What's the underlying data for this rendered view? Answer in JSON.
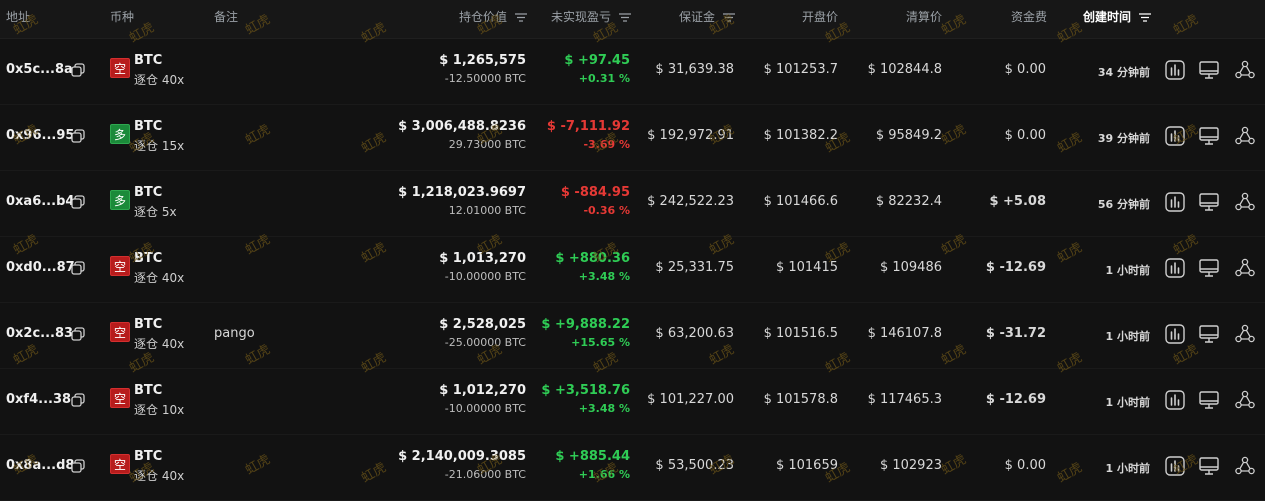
{
  "columns": {
    "address": "地址",
    "coin": "币种",
    "note": "备注",
    "position_value": "持仓价值",
    "unrealized_pnl": "未实现盈亏",
    "margin": "保证金",
    "open_price": "开盘价",
    "liq_price": "清算价",
    "funding": "资金费",
    "created": "创建时间"
  },
  "watermark": "虹虎",
  "rows": [
    {
      "address": "0x5c...8a",
      "side": "空",
      "side_type": "short",
      "coin": "BTC",
      "leverage": "逐仓 40x",
      "note": "",
      "value": "$ 1,265,575",
      "size": "-12.50000 BTC",
      "pnl": "$ +97.45",
      "pnl_pct": "+0.31 %",
      "pnl_dir": "pos",
      "margin": "$ 31,639.38",
      "open": "$ 101253.7",
      "liq": "$ 102844.8",
      "funding": "$ 0.00",
      "funding_dir": "zero",
      "created": "34 分钟前"
    },
    {
      "address": "0x96...95",
      "side": "多",
      "side_type": "long",
      "coin": "BTC",
      "leverage": "逐仓 15x",
      "note": "",
      "value": "$ 3,006,488.8236",
      "size": "29.73000 BTC",
      "pnl": "$ -7,111.92",
      "pnl_pct": "-3.69 %",
      "pnl_dir": "neg",
      "margin": "$ 192,972.91",
      "open": "$ 101382.2",
      "liq": "$ 95849.2",
      "funding": "$ 0.00",
      "funding_dir": "zero",
      "created": "39 分钟前"
    },
    {
      "address": "0xa6...b4",
      "side": "多",
      "side_type": "long",
      "coin": "BTC",
      "leverage": "逐仓 5x",
      "note": "",
      "value": "$ 1,218,023.9697",
      "size": "12.01000 BTC",
      "pnl": "$ -884.95",
      "pnl_pct": "-0.36 %",
      "pnl_dir": "neg",
      "margin": "$ 242,522.23",
      "open": "$ 101466.6",
      "liq": "$ 82232.4",
      "funding": "$ +5.08",
      "funding_dir": "pos",
      "created": "56 分钟前"
    },
    {
      "address": "0xd0...87",
      "side": "空",
      "side_type": "short",
      "coin": "BTC",
      "leverage": "逐仓 40x",
      "note": "",
      "value": "$ 1,013,270",
      "size": "-10.00000 BTC",
      "pnl": "$ +880.36",
      "pnl_pct": "+3.48 %",
      "pnl_dir": "pos",
      "margin": "$ 25,331.75",
      "open": "$ 101415",
      "liq": "$ 109486",
      "funding": "$ -12.69",
      "funding_dir": "neg",
      "created": "1 小时前"
    },
    {
      "address": "0x2c...83",
      "side": "空",
      "side_type": "short",
      "coin": "BTC",
      "leverage": "逐仓 40x",
      "note": "pango",
      "value": "$ 2,528,025",
      "size": "-25.00000 BTC",
      "pnl": "$ +9,888.22",
      "pnl_pct": "+15.65 %",
      "pnl_dir": "pos",
      "margin": "$ 63,200.63",
      "open": "$ 101516.5",
      "liq": "$ 146107.8",
      "funding": "$ -31.72",
      "funding_dir": "neg",
      "created": "1 小时前"
    },
    {
      "address": "0xf4...38",
      "side": "空",
      "side_type": "short",
      "coin": "BTC",
      "leverage": "逐仓 10x",
      "note": "",
      "value": "$ 1,012,270",
      "size": "-10.00000 BTC",
      "pnl": "$ +3,518.76",
      "pnl_pct": "+3.48 %",
      "pnl_dir": "pos",
      "margin": "$ 101,227.00",
      "open": "$ 101578.8",
      "liq": "$ 117465.3",
      "funding": "$ -12.69",
      "funding_dir": "neg",
      "created": "1 小时前"
    },
    {
      "address": "0x8a...d8",
      "side": "空",
      "side_type": "short",
      "coin": "BTC",
      "leverage": "逐仓 40x",
      "note": "",
      "value": "$ 2,140,009.3085",
      "size": "-21.06000 BTC",
      "pnl": "$ +885.44",
      "pnl_pct": "+1.66 %",
      "pnl_dir": "pos",
      "margin": "$ 53,500.23",
      "open": "$ 101659",
      "liq": "$ 102923",
      "funding": "$ 0.00",
      "funding_dir": "zero",
      "created": "1 小时前"
    }
  ]
}
